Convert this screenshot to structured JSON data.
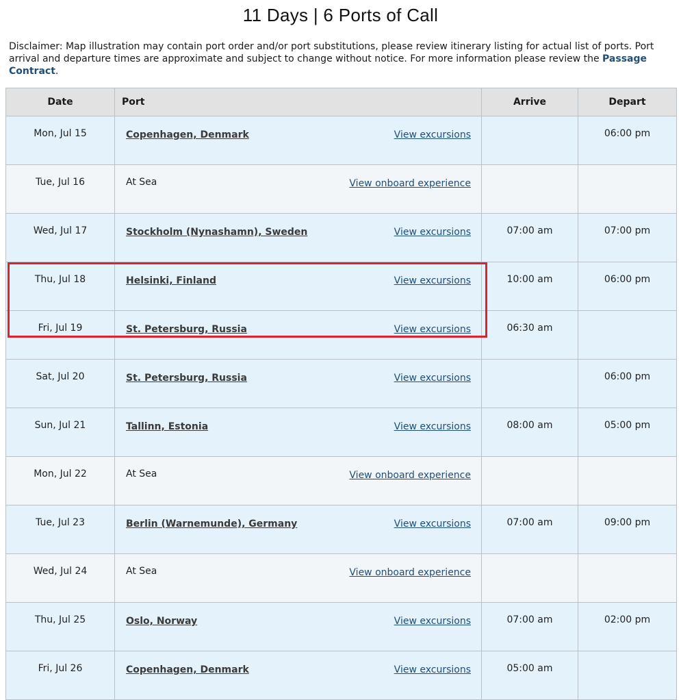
{
  "header": {
    "title": "11 Days | 6 Ports of Call",
    "disclaimer_text": "Disclaimer: Map illustration may contain port order and/or port substitutions, please review itinerary listing for actual list of ports. Port arrival and departure times are approximate and subject to change without notice. For more information please review the ",
    "disclaimer_link": "Passage Contract",
    "disclaimer_end": "."
  },
  "table": {
    "columns": [
      "Date",
      "Port",
      "Arrive",
      "Depart"
    ],
    "rows": [
      {
        "date": "Mon, Jul 15",
        "port": "Copenhagen, Denmark",
        "port_linked": true,
        "link": "View excursions",
        "arrive": "",
        "depart": "06:00 pm"
      },
      {
        "date": "Tue, Jul 16",
        "port": "At Sea",
        "port_linked": false,
        "link": "View onboard experience",
        "arrive": "",
        "depart": ""
      },
      {
        "date": "Wed, Jul 17",
        "port": "Stockholm (Nynashamn), Sweden",
        "port_linked": true,
        "link": "View excursions",
        "arrive": "07:00 am",
        "depart": "07:00 pm"
      },
      {
        "date": "Thu, Jul 18",
        "port": "Helsinki, Finland",
        "port_linked": true,
        "link": "View excursions",
        "arrive": "10:00 am",
        "depart": "06:00 pm"
      },
      {
        "date": "Fri, Jul 19",
        "port": "St. Petersburg, Russia",
        "port_linked": true,
        "link": "View excursions",
        "arrive": "06:30 am",
        "depart": ""
      },
      {
        "date": "Sat, Jul 20",
        "port": "St. Petersburg, Russia",
        "port_linked": true,
        "link": "View excursions",
        "arrive": "",
        "depart": "06:00 pm"
      },
      {
        "date": "Sun, Jul 21",
        "port": "Tallinn, Estonia",
        "port_linked": true,
        "link": "View excursions",
        "arrive": "08:00 am",
        "depart": "05:00 pm"
      },
      {
        "date": "Mon, Jul 22",
        "port": "At Sea",
        "port_linked": false,
        "link": "View onboard experience",
        "arrive": "",
        "depart": ""
      },
      {
        "date": "Tue, Jul 23",
        "port": "Berlin (Warnemunde), Germany",
        "port_linked": true,
        "link": "View excursions",
        "arrive": "07:00 am",
        "depart": "09:00 pm"
      },
      {
        "date": "Wed, Jul 24",
        "port": "At Sea",
        "port_linked": false,
        "link": "View onboard experience",
        "arrive": "",
        "depart": ""
      },
      {
        "date": "Thu, Jul 25",
        "port": "Oslo, Norway",
        "port_linked": true,
        "link": "View excursions",
        "arrive": "07:00 am",
        "depart": "02:00 pm"
      },
      {
        "date": "Fri, Jul 26",
        "port": "Copenhagen, Denmark",
        "port_linked": true,
        "link": "View excursions",
        "arrive": "05:00 am",
        "depart": ""
      }
    ]
  },
  "colors": {
    "link": "#1f4e79",
    "highlight": "#d9232e",
    "row_light_blue": "#e3f2fb",
    "row_light_gray": "#f2f6f9",
    "header_bg": "#e2e2e2"
  }
}
